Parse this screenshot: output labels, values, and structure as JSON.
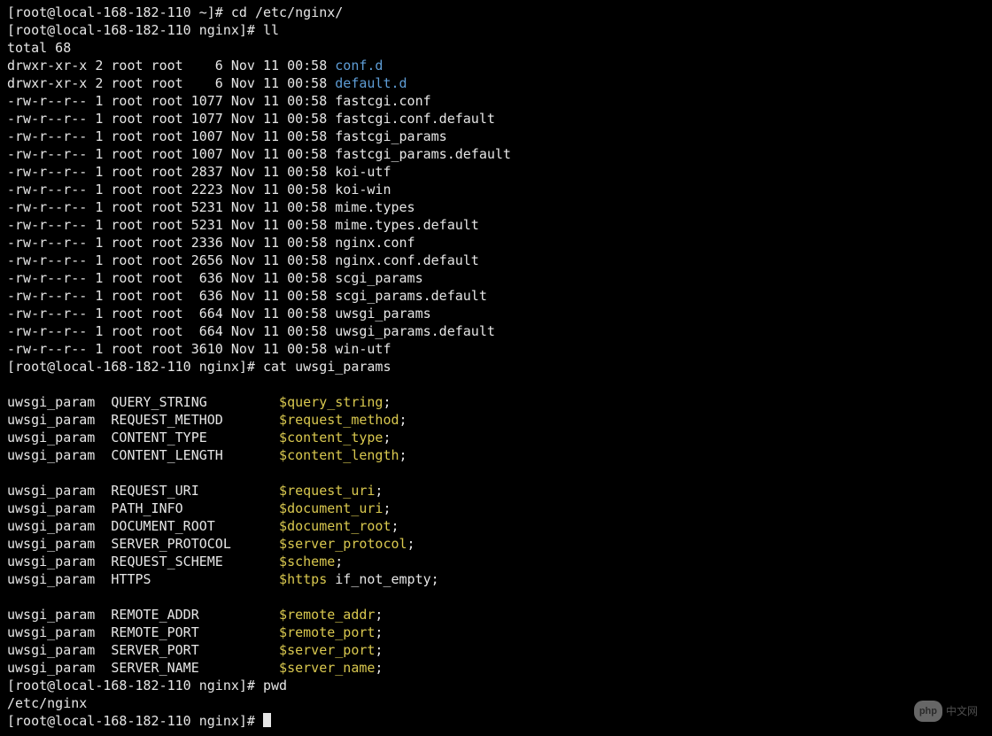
{
  "prompts": {
    "home": "[root@local-168-182-110 ~]# ",
    "nginx": "[root@local-168-182-110 nginx]# "
  },
  "commands": {
    "cd": "cd /etc/nginx/",
    "ll": "ll",
    "cat": "cat uwsgi_params",
    "pwd": "pwd"
  },
  "ll_header": "total 68",
  "ll_rows": [
    {
      "perm": "drwxr-xr-x",
      "n": "2",
      "own": "root",
      "grp": "root",
      "size": "   6",
      "date": "Nov 11 00:58",
      "name": "conf.d",
      "is_dir": true
    },
    {
      "perm": "drwxr-xr-x",
      "n": "2",
      "own": "root",
      "grp": "root",
      "size": "   6",
      "date": "Nov 11 00:58",
      "name": "default.d",
      "is_dir": true
    },
    {
      "perm": "-rw-r--r--",
      "n": "1",
      "own": "root",
      "grp": "root",
      "size": "1077",
      "date": "Nov 11 00:58",
      "name": "fastcgi.conf",
      "is_dir": false
    },
    {
      "perm": "-rw-r--r--",
      "n": "1",
      "own": "root",
      "grp": "root",
      "size": "1077",
      "date": "Nov 11 00:58",
      "name": "fastcgi.conf.default",
      "is_dir": false
    },
    {
      "perm": "-rw-r--r--",
      "n": "1",
      "own": "root",
      "grp": "root",
      "size": "1007",
      "date": "Nov 11 00:58",
      "name": "fastcgi_params",
      "is_dir": false
    },
    {
      "perm": "-rw-r--r--",
      "n": "1",
      "own": "root",
      "grp": "root",
      "size": "1007",
      "date": "Nov 11 00:58",
      "name": "fastcgi_params.default",
      "is_dir": false
    },
    {
      "perm": "-rw-r--r--",
      "n": "1",
      "own": "root",
      "grp": "root",
      "size": "2837",
      "date": "Nov 11 00:58",
      "name": "koi-utf",
      "is_dir": false
    },
    {
      "perm": "-rw-r--r--",
      "n": "1",
      "own": "root",
      "grp": "root",
      "size": "2223",
      "date": "Nov 11 00:58",
      "name": "koi-win",
      "is_dir": false
    },
    {
      "perm": "-rw-r--r--",
      "n": "1",
      "own": "root",
      "grp": "root",
      "size": "5231",
      "date": "Nov 11 00:58",
      "name": "mime.types",
      "is_dir": false
    },
    {
      "perm": "-rw-r--r--",
      "n": "1",
      "own": "root",
      "grp": "root",
      "size": "5231",
      "date": "Nov 11 00:58",
      "name": "mime.types.default",
      "is_dir": false
    },
    {
      "perm": "-rw-r--r--",
      "n": "1",
      "own": "root",
      "grp": "root",
      "size": "2336",
      "date": "Nov 11 00:58",
      "name": "nginx.conf",
      "is_dir": false
    },
    {
      "perm": "-rw-r--r--",
      "n": "1",
      "own": "root",
      "grp": "root",
      "size": "2656",
      "date": "Nov 11 00:58",
      "name": "nginx.conf.default",
      "is_dir": false
    },
    {
      "perm": "-rw-r--r--",
      "n": "1",
      "own": "root",
      "grp": "root",
      "size": " 636",
      "date": "Nov 11 00:58",
      "name": "scgi_params",
      "is_dir": false
    },
    {
      "perm": "-rw-r--r--",
      "n": "1",
      "own": "root",
      "grp": "root",
      "size": " 636",
      "date": "Nov 11 00:58",
      "name": "scgi_params.default",
      "is_dir": false
    },
    {
      "perm": "-rw-r--r--",
      "n": "1",
      "own": "root",
      "grp": "root",
      "size": " 664",
      "date": "Nov 11 00:58",
      "name": "uwsgi_params",
      "is_dir": false
    },
    {
      "perm": "-rw-r--r--",
      "n": "1",
      "own": "root",
      "grp": "root",
      "size": " 664",
      "date": "Nov 11 00:58",
      "name": "uwsgi_params.default",
      "is_dir": false
    },
    {
      "perm": "-rw-r--r--",
      "n": "1",
      "own": "root",
      "grp": "root",
      "size": "3610",
      "date": "Nov 11 00:58",
      "name": "win-utf",
      "is_dir": false
    }
  ],
  "uwsgi_groups": [
    [
      {
        "key": "QUERY_STRING",
        "var": "$query_string",
        "suffix": ";"
      },
      {
        "key": "REQUEST_METHOD",
        "var": "$request_method",
        "suffix": ";"
      },
      {
        "key": "CONTENT_TYPE",
        "var": "$content_type",
        "suffix": ";"
      },
      {
        "key": "CONTENT_LENGTH",
        "var": "$content_length",
        "suffix": ";"
      }
    ],
    [
      {
        "key": "REQUEST_URI",
        "var": "$request_uri",
        "suffix": ";"
      },
      {
        "key": "PATH_INFO",
        "var": "$document_uri",
        "suffix": ";"
      },
      {
        "key": "DOCUMENT_ROOT",
        "var": "$document_root",
        "suffix": ";"
      },
      {
        "key": "SERVER_PROTOCOL",
        "var": "$server_protocol",
        "suffix": ";"
      },
      {
        "key": "REQUEST_SCHEME",
        "var": "$scheme",
        "suffix": ";"
      },
      {
        "key": "HTTPS",
        "var": "$https",
        "suffix": " if_not_empty;"
      }
    ],
    [
      {
        "key": "REMOTE_ADDR",
        "var": "$remote_addr",
        "suffix": ";"
      },
      {
        "key": "REMOTE_PORT",
        "var": "$remote_port",
        "suffix": ";"
      },
      {
        "key": "SERVER_PORT",
        "var": "$server_port",
        "suffix": ";"
      },
      {
        "key": "SERVER_NAME",
        "var": "$server_name",
        "suffix": ";"
      }
    ]
  ],
  "uwsgi_param_label": "uwsgi_param",
  "pwd_output": "/etc/nginx",
  "watermark": {
    "badge": "php",
    "text": "中文网"
  }
}
